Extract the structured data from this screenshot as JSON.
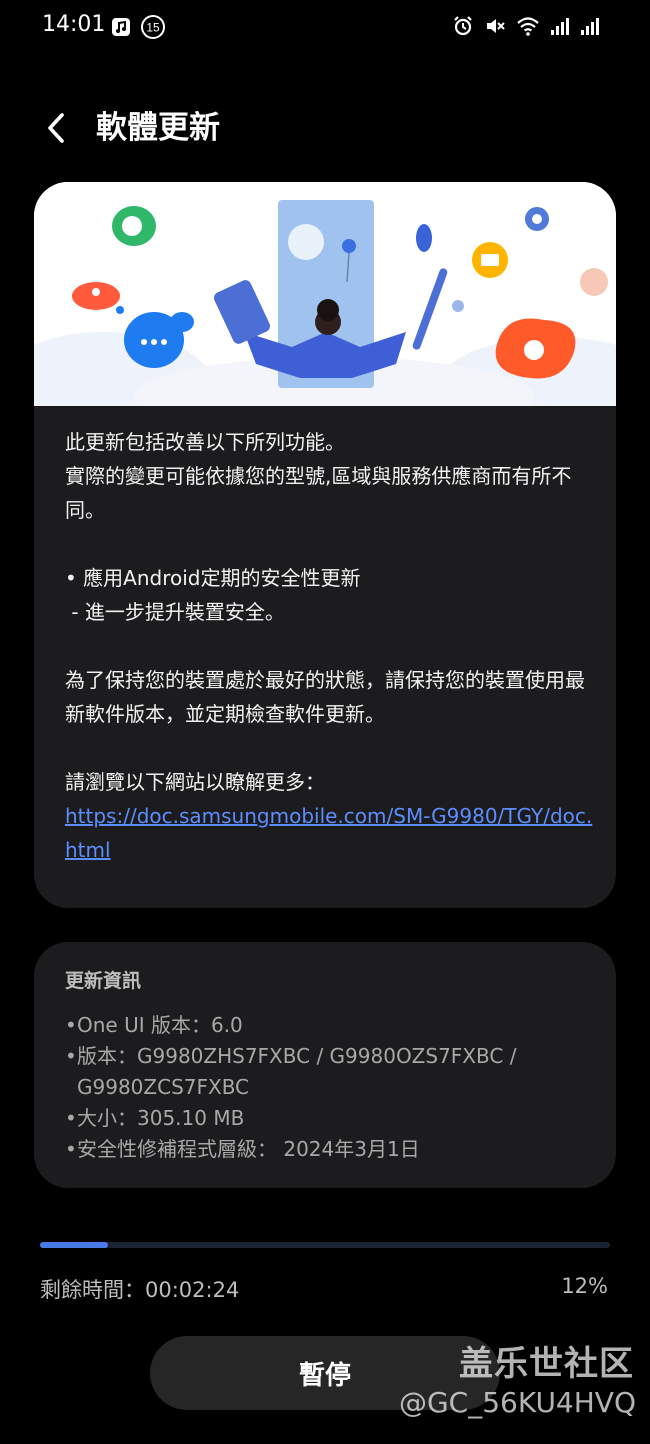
{
  "status_bar": {
    "time": "14:01",
    "badge": "15",
    "left_icons": [
      "music-note-icon",
      "notification-count-icon"
    ],
    "right_icons": [
      "alarm-icon",
      "mute-icon",
      "wifi-icon",
      "signal-icon",
      "signal-icon"
    ]
  },
  "header": {
    "back_icon": "chevron-left-icon",
    "title": "軟體更新"
  },
  "notes": {
    "line1": "此更新包括改善以下所列功能。",
    "line2": "實際的變更可能依據您的型號,區域與服務供應商而有所不同。",
    "bullet1": "• 應用Android定期的安全性更新",
    "bullet1_sub": " - 進一步提升裝置安全。",
    "para2": "為了保持您的裝置處於最好的狀態，請保持您的裝置使用最新軟件版本，並定期檢查軟件更新。",
    "more": "請瀏覽以下網站以瞭解更多：",
    "link": "https://doc.samsungmobile.com/SM-G9980/TGY/doc.html"
  },
  "info": {
    "title": "更新資訊",
    "items": [
      "One UI 版本：6.0",
      "版本：G9980ZHS7FXBC / G9980OZS7FXBC / G9980ZCS7FXBC",
      "大小：305.10 MB",
      "安全性修補程式層級： 2024年3月1日"
    ]
  },
  "progress": {
    "remaining_label": "剩餘時間：00:02:24",
    "percent_label": "12%",
    "value": 0.12
  },
  "pause_button": {
    "label": "暫停"
  },
  "watermark": {
    "line1": "盖乐世社区",
    "line2": "@GC_56KU4HVQ"
  },
  "colors": {
    "background": "#000000",
    "card": "#1c1c1e",
    "link": "#5c8dff",
    "progress": "#4a79e8",
    "button": "#262626"
  }
}
